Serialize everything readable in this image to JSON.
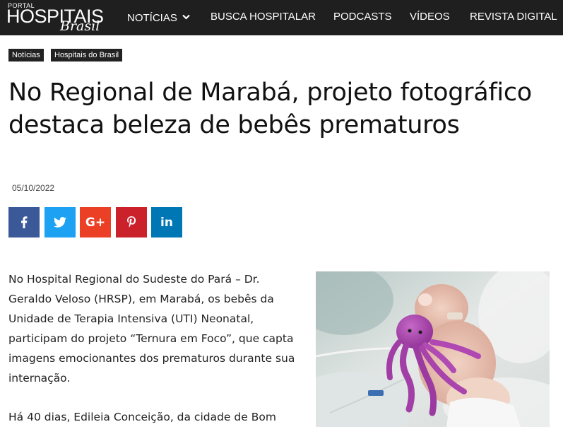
{
  "header": {
    "logo": {
      "portal": "PORTAL",
      "main": "HOSPITAIS",
      "sub": "Brasil"
    },
    "nav": [
      {
        "label": "NOTÍCIAS",
        "has_dropdown": true
      },
      {
        "label": "BUSCA HOSPITALAR"
      },
      {
        "label": "PODCASTS"
      },
      {
        "label": "VÍDEOS"
      },
      {
        "label": "REVISTA DIGITAL"
      }
    ],
    "background": "#1f1f1f"
  },
  "article": {
    "tags": [
      "Notícias",
      "Hospitais do Brasil"
    ],
    "title": "No Regional de Marabá, projeto fotográfico destaca beleza de bebês prematuros",
    "date": "05/10/2022",
    "paragraphs": [
      "No Hospital Regional do Sudeste do Pará – Dr. Geraldo Veloso (HRSP), em Marabá, os bebês da Unidade de Terapia Intensiva (UTI) Neonatal, participam do projeto “Ternura em Foco”, que capta imagens emocionantes dos prematuros durante sua internação.",
      "Há 40 dias, Edileia Conceição, da cidade de Bom"
    ]
  },
  "share_buttons": [
    {
      "network": "facebook",
      "icon": "facebook-icon",
      "glyph": "f",
      "color": "#3b5998"
    },
    {
      "network": "twitter",
      "icon": "twitter-icon",
      "glyph": "",
      "color": "#1da1f2"
    },
    {
      "network": "google-plus",
      "icon": "google-plus-icon",
      "glyph": "G+",
      "color": "#eb4026"
    },
    {
      "network": "pinterest",
      "icon": "pinterest-icon",
      "glyph": "P",
      "color": "#ca212a"
    },
    {
      "network": "linkedin",
      "icon": "linkedin-icon",
      "glyph": "in",
      "color": "#0077b5"
    }
  ]
}
